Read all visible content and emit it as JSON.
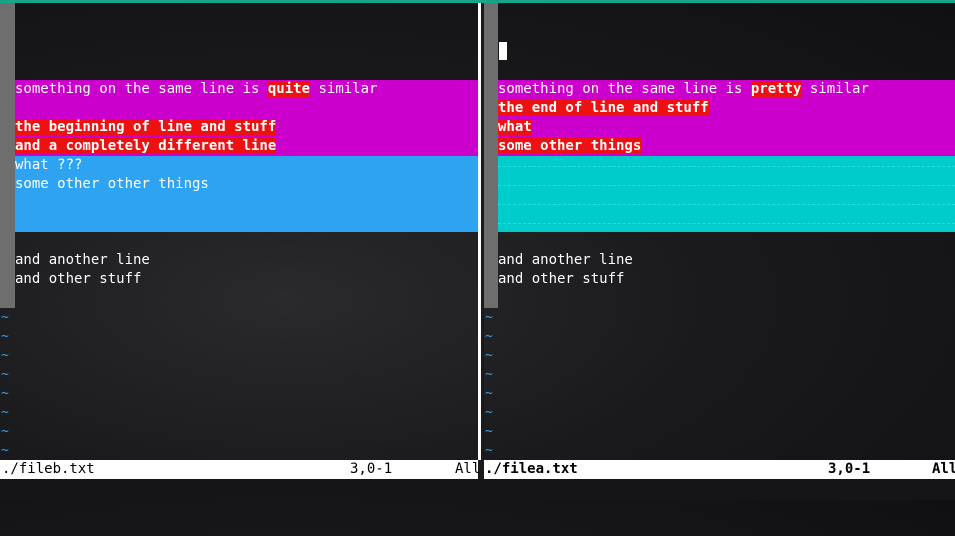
{
  "left": {
    "lines": [
      {
        "pre": "something on the same line is ",
        "hl": "quite",
        "post": " similar"
      },
      {
        "text": "the beginning of line and stuff"
      },
      {
        "text": "and a completely different line"
      },
      {
        "text": "what ???"
      },
      {
        "text": "some other other things"
      },
      {
        "text": "and another line"
      },
      {
        "text": "and other stuff"
      }
    ],
    "status": {
      "file": "./fileb.txt",
      "pos": "3,0-1",
      "scroll": "All"
    }
  },
  "right": {
    "lines": [
      {
        "pre": "something on the same line is ",
        "hl": "pretty",
        "post": " similar"
      },
      {
        "text": "the end of line and stuff"
      },
      {
        "text": "what"
      },
      {
        "text": "some other things"
      },
      {
        "text": "and another line"
      },
      {
        "text": "and other stuff"
      }
    ],
    "status": {
      "file": "./filea.txt",
      "pos": "3,0-1",
      "scroll": "All"
    }
  },
  "tilde": "~",
  "colors": {
    "change": "#cc00cc",
    "add": "#2ea3f2",
    "filler": "#00cccc",
    "highlight": "#ee1111",
    "tilde": "#2ea3f2"
  }
}
